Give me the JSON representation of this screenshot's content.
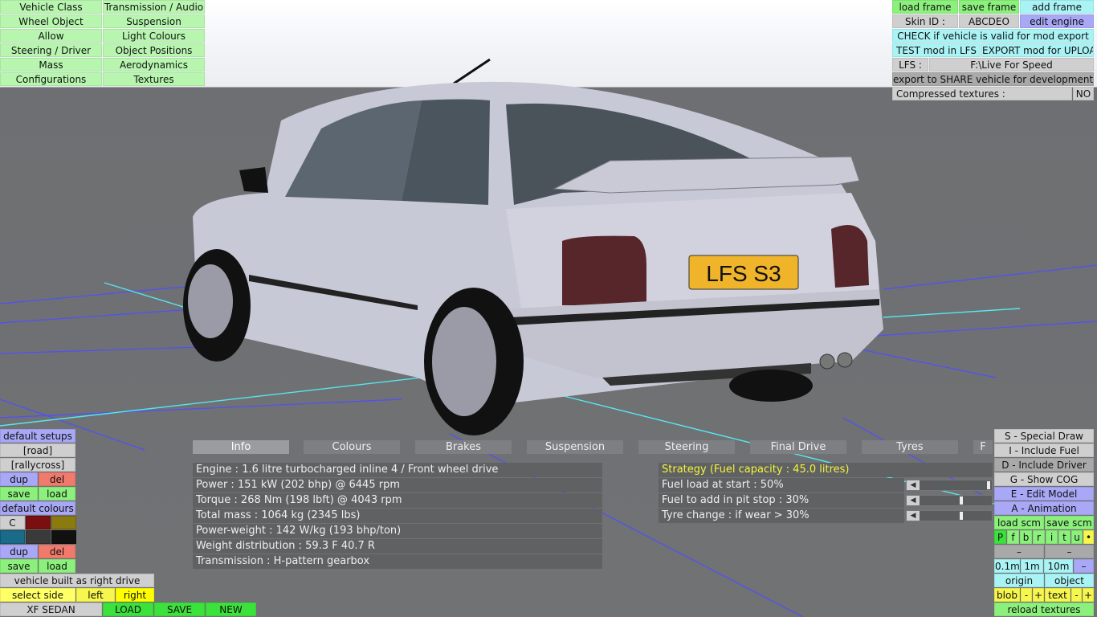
{
  "menu_left": {
    "col1": [
      "Vehicle Class",
      "Wheel Object",
      "Allow",
      "Steering / Driver",
      "Mass",
      "Configurations"
    ],
    "col2": [
      "Transmission / Audio",
      "Suspension",
      "Light Colours",
      "Object Positions",
      "Aerodynamics",
      "Textures"
    ]
  },
  "top_right": {
    "load_frame": "load frame",
    "save_frame": "save frame",
    "add_frame": "add frame",
    "skin_label": "Skin ID :",
    "skin_value": "ABCDEO",
    "edit_engine": "edit engine",
    "check_valid": "CHECK if vehicle is valid for mod export",
    "test_mod": "TEST mod in LFS",
    "export_mod": "EXPORT mod for UPLOAD",
    "lfs_label": "LFS :",
    "lfs_path": "F:\\Live For Speed",
    "export_share": "export to SHARE vehicle for development",
    "compressed_label": "Compressed textures :",
    "compressed_value": "NO"
  },
  "car": {
    "plate": "LFS S3"
  },
  "tabs": [
    "Info",
    "Colours",
    "Brakes",
    "Suspension",
    "Steering",
    "Final Drive",
    "Tyres",
    "F"
  ],
  "info_rows": [
    "Engine : 1.6 litre turbocharged inline 4 / Front wheel drive",
    "Power : 151 kW (202 bhp) @ 6445 rpm",
    "Torque : 268 Nm (198 lbft) @ 4043 rpm",
    "Total mass : 1064 kg (2345 lbs)",
    "Power-weight : 142 W/kg (193 bhp/ton)",
    "Weight distribution : 59.3 F  40.7 R",
    "Transmission : H-pattern gearbox"
  ],
  "strategy": {
    "title": "Strategy (Fuel capacity : 45.0 litres)",
    "rows": [
      {
        "label": "Fuel load at start : 50%",
        "value": 0.5
      },
      {
        "label": "Fuel to add in pit stop : 30%",
        "value": 0.3
      },
      {
        "label": "Tyre change : if wear > 30%",
        "value": 0.3
      }
    ]
  },
  "left_panel": {
    "default_setups": "default setups",
    "road": "[road]",
    "rallycross": "[rallycross]",
    "dup": "dup",
    "del": "del",
    "save": "save",
    "load": "load",
    "default_colours": "default colours",
    "c_label": "C",
    "built_as": "vehicle built as right drive",
    "select_side": "select side",
    "left": "left",
    "right": "right",
    "car_name": "XF SEDAN",
    "load_btn": "LOAD",
    "save_btn": "SAVE",
    "new_btn": "NEW",
    "swatches": [
      "#7a0f0f",
      "#8a7a10",
      "#1a6b8a",
      "#3a3a3a",
      "#111111"
    ]
  },
  "right_panel": {
    "special_draw": "S - Special Draw",
    "include_fuel": "I - Include Fuel",
    "include_driver": "D - Include Driver",
    "show_cog": "G - Show COG",
    "edit_model": "E - Edit Model",
    "animation": "A - Animation",
    "load_scm": "load scm",
    "save_scm": "save scm",
    "letters": [
      "P",
      "f",
      "b",
      "r",
      "i",
      "t",
      "u"
    ],
    "dot": "•",
    "dash1": "–",
    "dash2": "–",
    "steps": [
      "0.1m",
      "1m",
      "10m"
    ],
    "minus": "–",
    "origin": "origin",
    "object": "object",
    "blob": "blob",
    "text": "text",
    "minus_s": "-",
    "plus_s": "+",
    "reload_textures": "reload textures"
  }
}
